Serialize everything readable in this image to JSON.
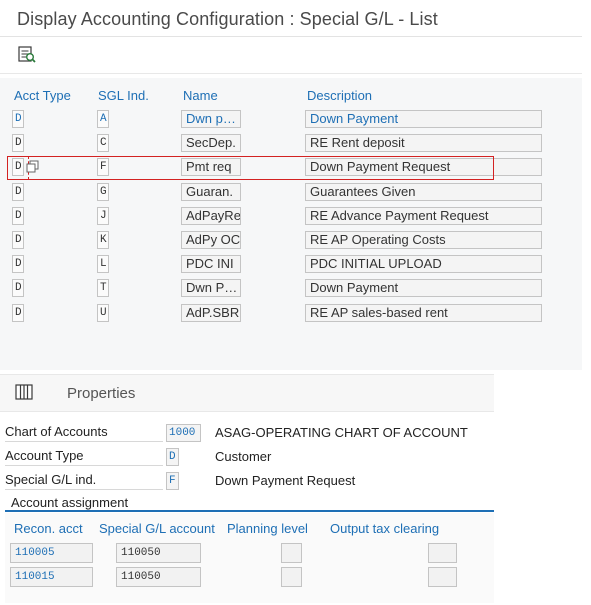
{
  "header": {
    "title": "Display Accounting Configuration : Special G/L - List"
  },
  "toolbar": {
    "details_icon": "details-view-icon"
  },
  "table": {
    "columns": [
      "Acct Type",
      "SGL Ind.",
      "Name",
      "Description"
    ],
    "rows": [
      {
        "acct_type": "D",
        "sgl_ind": "A",
        "name": "Dwn p…",
        "description": "Down Payment"
      },
      {
        "acct_type": "D",
        "sgl_ind": "C",
        "name": "SecDep.",
        "description": "RE Rent deposit"
      },
      {
        "acct_type": "D",
        "sgl_ind": "F",
        "name": "Pmt req",
        "description": "Down Payment Request"
      },
      {
        "acct_type": "D",
        "sgl_ind": "G",
        "name": "Guaran.",
        "description": "Guarantees Given"
      },
      {
        "acct_type": "D",
        "sgl_ind": "J",
        "name": "AdPayRe",
        "description": "RE Advance Payment Request"
      },
      {
        "acct_type": "D",
        "sgl_ind": "K",
        "name": "AdPy OC",
        "description": "RE AP Operating Costs"
      },
      {
        "acct_type": "D",
        "sgl_ind": "L",
        "name": "PDC INI",
        "description": "PDC INITIAL UPLOAD"
      },
      {
        "acct_type": "D",
        "sgl_ind": "T",
        "name": "Dwn P…",
        "description": "Down Payment"
      },
      {
        "acct_type": "D",
        "sgl_ind": "U",
        "name": "AdP.SBR",
        "description": "RE AP sales-based rent"
      }
    ],
    "selected_row": 2
  },
  "properties": {
    "title": "Properties",
    "fields": [
      {
        "label": "Chart of Accounts",
        "value": "1000",
        "text": "ASAG-OPERATING CHART OF ACCOUNT"
      },
      {
        "label": "Account Type",
        "value": "D",
        "text": "Customer"
      },
      {
        "label": "Special G/L ind.",
        "value": "F",
        "text": "Down Payment Request"
      }
    ]
  },
  "assignment": {
    "title": "Account assignment",
    "columns": [
      "Recon. acct",
      "Special G/L account",
      "Planning level",
      "Output tax clearing"
    ],
    "rows": [
      {
        "recon": "110005",
        "special": "110050"
      },
      {
        "recon": "110015",
        "special": "110050"
      }
    ]
  },
  "colors": {
    "accent": "#1e6fb5",
    "highlight": "#d32222"
  }
}
